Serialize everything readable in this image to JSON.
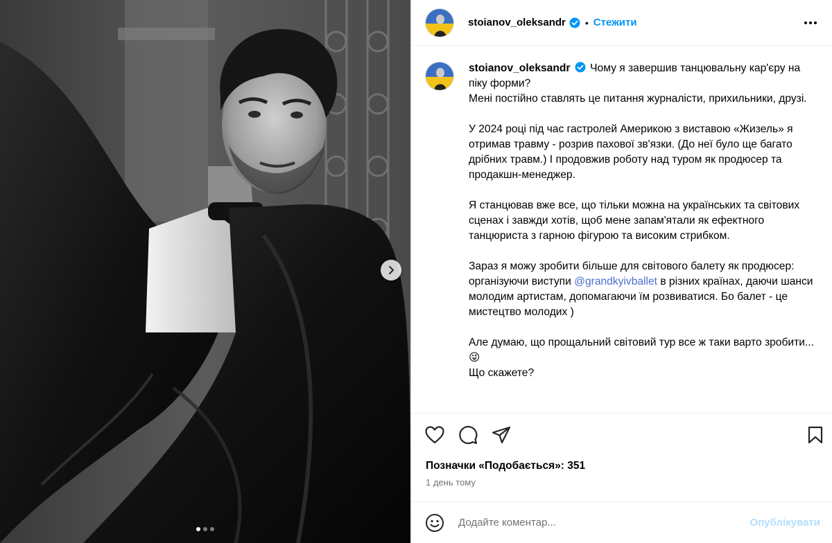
{
  "post": {
    "username": "stoianov_oleksandr",
    "separator": "•",
    "follow_label": "Стежити",
    "caption": {
      "username": "stoianov_oleksandr",
      "line1_text": "Чому я завершив танцювальну кар'єру на піку форми?",
      "line2": "Мені постійно ставлять це питання журналісти, прихильники, друзі.",
      "para2": "У 2024 році під час гастролей Америкою з виставою «Жизель» я отримав травму - розрив пахової зв'язки. (До неї було ще багато дрібних травм.) І продовжив роботу над туром як продюсер та продакшн-менеджер.",
      "para3": "Я станцював вже все, що тільки можна на українських та світових сценах і завжди хотів, щоб мене запам'ятали як ефектного танцюриста з гарною фігурою та високим стрибком.",
      "para4_before": "Зараз я можу зробити більше для світового балету як продюсер: організуючи виступи ",
      "para4_mention": "@grandkyivballet",
      "para4_after": " в різних країнах, даючи шанси молодим артистам, допомагаючи їм розвиватися. Бо балет - це мистецтво молодих )",
      "para5_text": "Але думаю, що прощальний світовий тур все ж таки варто зробити... ",
      "para5_emoji": "😜",
      "para6": "Що скажете?"
    },
    "likes_label": "Позначки «Подобається»: ",
    "likes_count": "351",
    "time_ago": "1 день тому",
    "comment_placeholder": "Додайте коментар...",
    "publish_label": "Опублікувати"
  },
  "carousel": {
    "count": 3,
    "active_index": 0
  },
  "icons": {
    "verified": "verified-badge-icon",
    "more": "more-options-icon",
    "like": "heart-icon",
    "comment": "comment-icon",
    "share": "share-icon",
    "save": "bookmark-icon",
    "emoji": "emoji-icon",
    "next": "chevron-right-icon"
  },
  "colors": {
    "accent": "#0095f6",
    "verified": "#0095f6",
    "mention": "#4a6fd1",
    "publish_disabled": "#b2dffc",
    "muted": "#737373"
  }
}
